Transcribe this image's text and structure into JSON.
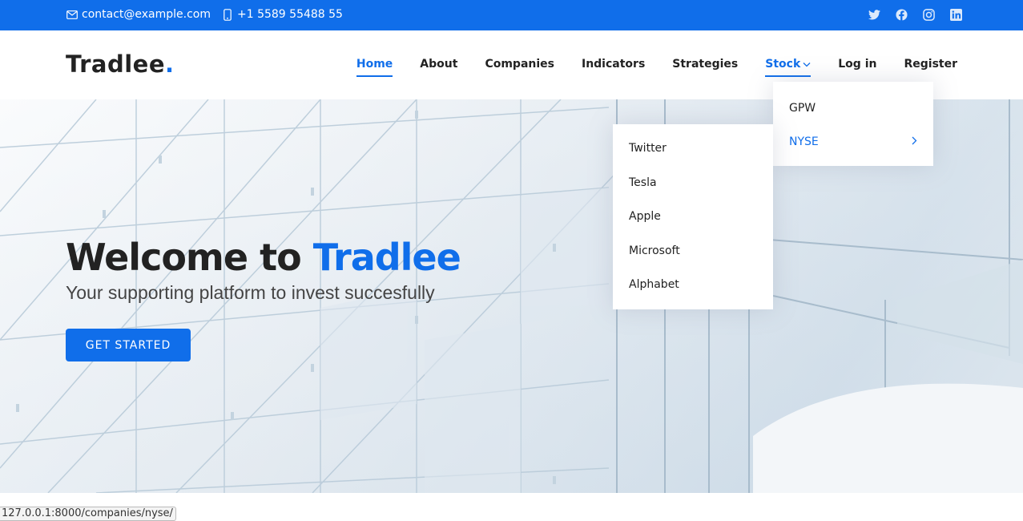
{
  "topbar": {
    "email": "contact@example.com",
    "phone": "+1 5589 55488 55",
    "social": [
      "twitter-icon",
      "facebook-icon",
      "instagram-icon",
      "linkedin-icon"
    ],
    "color": "#106eea"
  },
  "header": {
    "logo": "Tradlee",
    "logo_dot": ".",
    "nav": {
      "home": "Home",
      "about": "About",
      "companies": "Companies",
      "indicators": "Indicators",
      "strategies": "Strategies",
      "stock": "Stock",
      "login": "Log in",
      "register": "Register"
    }
  },
  "hero": {
    "title_prefix": "Welcome to ",
    "title_brand": "Tradlee",
    "subtitle": "Your supporting platform to invest succesfully",
    "cta": "GET STARTED"
  },
  "stock_menu": {
    "items": [
      "GPW",
      "NYSE"
    ]
  },
  "nyse_menu": {
    "items": [
      "Twitter",
      "Tesla",
      "Apple",
      "Microsoft",
      "Alphabet"
    ]
  },
  "status_url": "127.0.0.1:8000/companies/nyse/"
}
